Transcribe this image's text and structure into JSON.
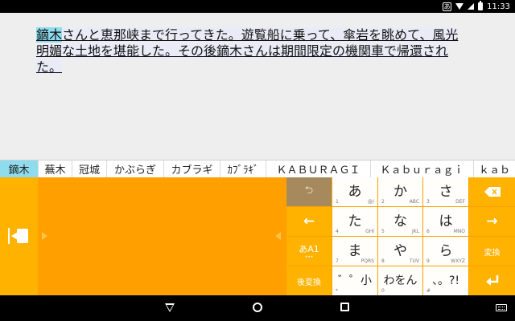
{
  "status_bar": {
    "ime_indicator": "あ",
    "icons": [
      "wifi-icon",
      "cell-signal-icon",
      "battery-icon"
    ],
    "time": "11:33"
  },
  "editor": {
    "highlighted": "鏑木",
    "line1": "さんと恵那峡まで行ってきた。遊覧船に乗って、傘岩を眺めて、風光",
    "line2": "明媚な土地を堪能した。その後鏑木さんは期間限定の機関車で帰還され",
    "line3": "た。"
  },
  "candidates": [
    {
      "text": "鏑木",
      "selected": true
    },
    {
      "text": "蕪木"
    },
    {
      "text": "冠城"
    },
    {
      "text": "かぶらぎ"
    },
    {
      "text": "カブラギ"
    },
    {
      "text": "ｶﾌﾞﾗｷﾞ"
    },
    {
      "text": "ＫＡＢＵＲＡＧＩ"
    },
    {
      "text": "Ｋａｂｕｒａｇｉ"
    },
    {
      "text": "ｋａｂ"
    }
  ],
  "keyboard": {
    "undo_label": "⮌",
    "row1": [
      {
        "main": "あ",
        "sub_left": "1",
        "sub_right": "@/"
      },
      {
        "main": "か",
        "sub_left": "2",
        "sub_right": "ABC"
      },
      {
        "main": "さ",
        "sub_left": "3",
        "sub_right": "DEF"
      }
    ],
    "row2": [
      {
        "main": "た",
        "sub_left": "4",
        "sub_right": "GHI"
      },
      {
        "main": "な",
        "sub_left": "5",
        "sub_right": "JKL"
      },
      {
        "main": "は",
        "sub_left": "6",
        "sub_right": "MNO"
      }
    ],
    "row3": [
      {
        "main": "ま",
        "sub_left": "7",
        "sub_right": "PQRS"
      },
      {
        "main": "や",
        "sub_left": "8",
        "sub_right": "TUV"
      },
      {
        "main": "ら",
        "sub_left": "9",
        "sub_right": "WXYZ"
      }
    ],
    "row4": [
      {
        "main": "゛゜小",
        "sub_left": "*",
        "sub_right": ""
      },
      {
        "main": "わをん",
        "sub_left": "0",
        "sub_right": ""
      },
      {
        "main": "、。?!",
        "sub_left": "#",
        "sub_right": ""
      }
    ],
    "left_arrow": "←",
    "mode_label": "あA1",
    "mode_dots": "•••",
    "kouhen_label": "後変換",
    "right_arrow": "→",
    "henkan_label": "変換",
    "backspace_icon": "backspace-icon",
    "enter_icon": "enter-icon"
  },
  "nav_bar": {
    "icons": [
      "back-icon",
      "home-icon",
      "recents-icon",
      "keyboard-switch-icon"
    ]
  }
}
